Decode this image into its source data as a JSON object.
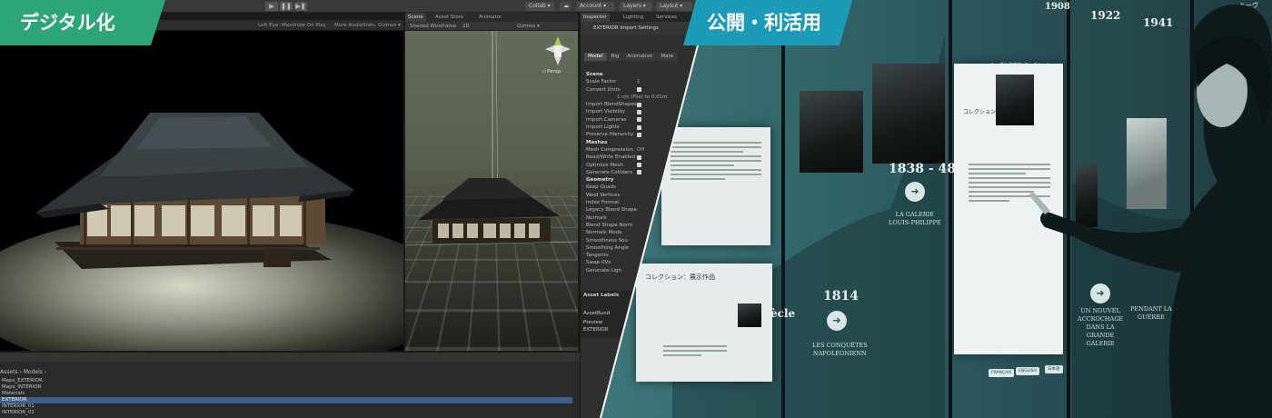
{
  "labels": {
    "left": "デジタル化",
    "right": "公開・利活用"
  },
  "colors": {
    "left_label_bg": "#2ea577",
    "right_label_bg": "#1c9bb8",
    "museum_teal": "#3f7a7c",
    "editor_bg": "#1b1b1b"
  },
  "editor": {
    "toolbar": {
      "collab": "Collab ▾",
      "account": "Account ▾",
      "layers": "Layers ▾",
      "layout": "Layout ▾"
    },
    "game_toolbar": {
      "scale": "Left Eye",
      "maximize": "Maximize On Play",
      "mute": "Mute Audio",
      "stats": "Stats",
      "gizmos": "Gizmos ▾"
    },
    "scene_tabs": [
      "Scene",
      "Asset Store",
      "Animator"
    ],
    "scene_toolbar": {
      "shading": "Shaded Wireframe",
      "mode_2d": "2D",
      "gizmos": "Gizmos ▾"
    },
    "scene_gizmo_label": "◁ Persp",
    "project": {
      "path": "Assets › Models ›",
      "items": [
        {
          "name": "Maps_EXTERIOR",
          "selected": false
        },
        {
          "name": "Maps_INTERIOR",
          "selected": false
        },
        {
          "name": "Materials",
          "selected": false
        },
        {
          "name": "EXTERIOR",
          "selected": true
        },
        {
          "name": "INTERIOR_01",
          "selected": false
        },
        {
          "name": "INTERIOR_02",
          "selected": false
        }
      ]
    },
    "inspector": {
      "tabs": [
        "Inspector",
        "Lighting",
        "Services"
      ],
      "header": "EXTERIOR Import Settings",
      "subtabs": [
        "Model",
        "Rig",
        "Animation",
        "Mate"
      ],
      "rows": [
        {
          "label": "Scene",
          "type": "section"
        },
        {
          "label": "Scale Factor",
          "type": "value",
          "value": "1"
        },
        {
          "label": "Convert Units",
          "type": "check"
        },
        {
          "label": "",
          "type": "value",
          "value": "1 cm (File) to 0.01m"
        },
        {
          "label": "Import BlendShapes",
          "type": "check"
        },
        {
          "label": "Import Visibility",
          "type": "check"
        },
        {
          "label": "Import Cameras",
          "type": "check"
        },
        {
          "label": "Import Lights",
          "type": "check"
        },
        {
          "label": "Preserve Hierarchy",
          "type": "check"
        },
        {
          "label": "Meshes",
          "type": "section"
        },
        {
          "label": "Mesh Compression",
          "type": "value",
          "value": "Off"
        },
        {
          "label": "Read/Write Enabled",
          "type": "check"
        },
        {
          "label": "Optimize Mesh",
          "type": "check"
        },
        {
          "label": "Generate Colliders",
          "type": "check"
        },
        {
          "label": "Geometry",
          "type": "section"
        },
        {
          "label": "Keep Quads",
          "type": "plain"
        },
        {
          "label": "Weld Vertices",
          "type": "plain"
        },
        {
          "label": "Index Format",
          "type": "plain"
        },
        {
          "label": "Legacy Blend Shape",
          "type": "plain"
        },
        {
          "label": "Normals",
          "type": "plain"
        },
        {
          "label": "Blend Shape Norm",
          "type": "plain"
        },
        {
          "label": "Normals Mode",
          "type": "plain"
        },
        {
          "label": "Smoothness Sou",
          "type": "plain"
        },
        {
          "label": "Smoothing Angle",
          "type": "plain"
        },
        {
          "label": "Tangents",
          "type": "plain"
        },
        {
          "label": "Swap UVs",
          "type": "plain"
        },
        {
          "label": "Generate Ligh",
          "type": "plain"
        }
      ],
      "footer": {
        "asset_labels": "Asset Labels",
        "asset_bundle": "AssetBund",
        "preview": "Preview",
        "preview_name": "EXTERIOR"
      }
    }
  },
  "museum": {
    "timeline": [
      {
        "year": "1838 - 48",
        "caption": "LA GALERIE\nLOUIS-PHILIPPE"
      },
      {
        "year": "1814",
        "caption": "LES CONQUÊTES\nNAPOLÉONIENN"
      },
      {
        "year": "1922",
        "caption": ""
      },
      {
        "year": "1941",
        "caption": ""
      },
      {
        "year": "1908",
        "caption": ""
      }
    ],
    "lower_caption": "UN NOUVEL\nACCROCHAGE\nDANS LA\nGRANDE\nGALERIE",
    "side_caption": "PENDANT LA\nGUERRE",
    "collection_card_title": "コレクション：展示作品",
    "collection_card_title_2": "コレクション",
    "card_heading_small": "ルーヴル美術館 コレクション",
    "partial_word": "ècle",
    "lang_buttons": [
      "FRANÇAIS",
      "ENGLISH",
      "日本語"
    ],
    "corner_text": "ルーヴ"
  }
}
